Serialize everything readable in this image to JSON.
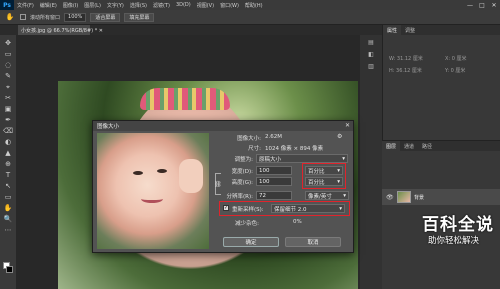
{
  "menubar": {
    "logo": "Ps",
    "items": [
      "文件(F)",
      "编辑(E)",
      "图像(I)",
      "图层(L)",
      "文字(Y)",
      "选择(S)",
      "滤镜(T)",
      "3D(D)",
      "视图(V)",
      "窗口(W)",
      "帮助(H)"
    ],
    "window_buttons": [
      "—",
      "□",
      "✕"
    ]
  },
  "optbar": {
    "scroll_all_label": "滚动所有窗口",
    "zoom_value": "100%",
    "fit_screen_label": "适合屏幕",
    "fill_screen_label": "填充屏幕"
  },
  "doctab": {
    "label": "小女孩.jpg @ 66.7%(RGB/8#) *  ✕"
  },
  "toolbar": {
    "icons": [
      "✥",
      "▭",
      "◌",
      "✎",
      "⌖",
      "✂",
      "▣",
      "✒",
      "⌫",
      "◐",
      "▲",
      "⊕",
      "T",
      "↖",
      "▭",
      "✋",
      "🔍",
      "⋯"
    ]
  },
  "right_icons": [
    "▤",
    "◧",
    "▥"
  ],
  "props_panel": {
    "tabs": [
      "属性",
      "调整"
    ],
    "rows": [
      "W: 31.12 厘米",
      "X:  0 厘米",
      "H: 36.12 厘米",
      "Y:  0 厘米"
    ]
  },
  "layers_panel": {
    "tabs": [
      "图层",
      "通道",
      "路径"
    ],
    "layer_name": "背景"
  },
  "dialog": {
    "title": "图像大小",
    "close": "✕",
    "gear": "⚙",
    "image_size_label": "图像大小:",
    "image_size_value": "2.62M",
    "dimensions_label": "尺寸:",
    "dimensions_value": "1024 像素 × 894 像素",
    "fit_label": "调整为:",
    "fit_value": "原稿大小",
    "width_label": "宽度(D):",
    "width_value": "100",
    "width_unit": "百分比",
    "height_label": "高度(G):",
    "height_value": "100",
    "height_unit": "百分比",
    "resolution_label": "分辨率(R):",
    "resolution_value": "72",
    "resolution_unit": "像素/英寸",
    "resample_label": "重新采样(S):",
    "resample_value": "保留细节 2.0",
    "noise_label": "减少杂色:",
    "noise_value": "0%",
    "ok_label": "确定",
    "cancel_label": "取消",
    "check_mark": "✓"
  },
  "watermark": {
    "title": "百科全说",
    "subtitle": "助你轻松解决"
  },
  "colors": {
    "highlight_box": "#e0242c",
    "dialog_bg": "#535353"
  }
}
